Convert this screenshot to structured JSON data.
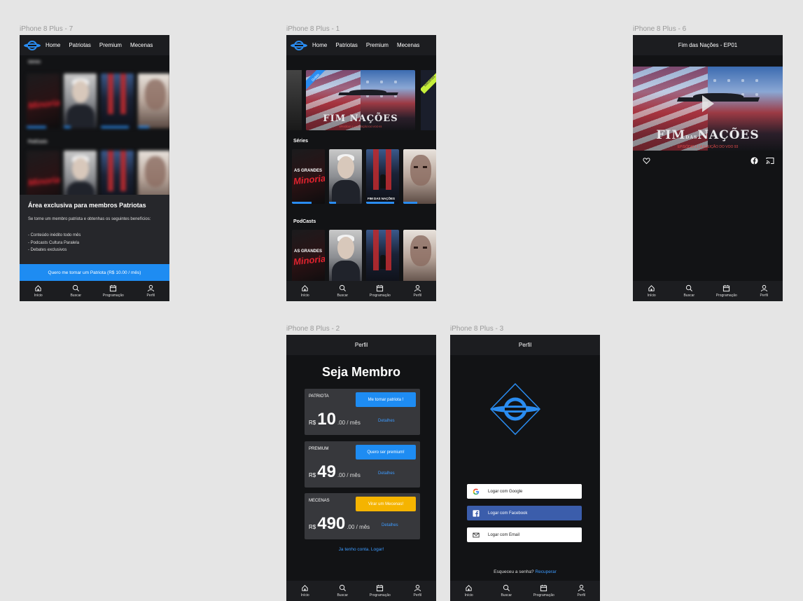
{
  "frames": {
    "f7": "iPhone 8 Plus - 7",
    "f1": "iPhone 8 Plus - 1",
    "f6": "iPhone 8 Plus - 6",
    "f2": "iPhone 8 Plus - 2",
    "f3": "iPhone 8 Plus - 3"
  },
  "nav": {
    "home": "Home",
    "patriotas": "Patriotas",
    "premium": "Premium",
    "mecenas": "Mecenas"
  },
  "tabs": {
    "inicio": "Início",
    "buscar": "Buscar",
    "programacao": "Programação",
    "perfil": "Perfil"
  },
  "sections": {
    "series": "Séries",
    "podcasts": "PodCasts"
  },
  "posters": {
    "minoria_top": "AS GRANDES",
    "minoria_big": "Minoria",
    "fim_caption": "FIM DAS NAÇÕES"
  },
  "exclusive": {
    "title": "Área exclusiva para membros Patriotas",
    "intro": "Se torne um membro patriota e obtenhas os seguintes benefícios:",
    "benefits": [
      "- Conteúdo inédito todo mês",
      "- Podcasts Cultura Paralela",
      "- Debates exclusivos"
    ],
    "cta": "Quero me tornar um Patriota (R$ 10.00 / mês)"
  },
  "hero": {
    "title_left": "FIM",
    "title_right": "NAÇÕES",
    "title_mid": "DAS",
    "subtitle": "EPISÓDIO 1 | A ELEIÇÃO DO VOO 93",
    "ribbon_left": "Grátis",
    "ribbon_right": "Mecenas"
  },
  "player": {
    "title": "Fim das Nações - EP01"
  },
  "membership": {
    "header": "Perfil",
    "heading": "Seja Membro",
    "currency": "R$",
    "per": ".00 / mês",
    "details": "Detalhes",
    "plans": [
      {
        "name": "PATRIOTA",
        "button": "Me tornar patriota !",
        "amount": "10",
        "color": "#1e8cf2"
      },
      {
        "name": "PREMIUM",
        "button": "Quero ser premium!",
        "amount": "49",
        "color": "#1e8cf2"
      },
      {
        "name": "MECENAS",
        "button": "Virar um Mecenas!",
        "amount": "490",
        "color": "#f5b400"
      }
    ],
    "login_link": "Ja tenho conta. Logar!"
  },
  "login": {
    "header": "Perfil",
    "google": "Logar com Google",
    "facebook": "Logar com Facebook",
    "email": "Logar com Email",
    "forgot": "Esqueceu a senha?",
    "recover": "Recuperar"
  },
  "colors": {
    "accent": "#2a8cf0",
    "facebook": "#3b5dab",
    "mecenas": "#f5b400",
    "bg": "#121315",
    "bar": "#1c1d20"
  }
}
